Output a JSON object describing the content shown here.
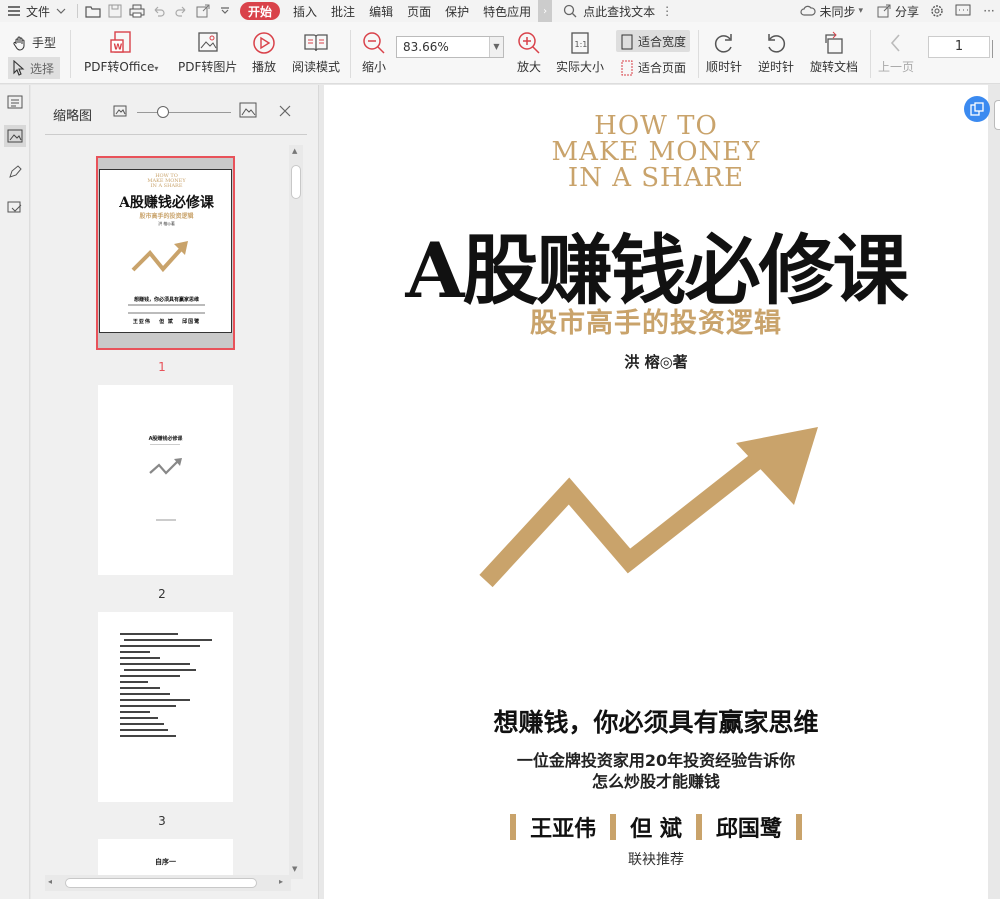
{
  "menu": {
    "file": "文件",
    "tabs": [
      "开始",
      "插入",
      "批注",
      "编辑",
      "页面",
      "保护",
      "特色应用"
    ],
    "search": "点此查找文本",
    "sync": "未同步",
    "share": "分享"
  },
  "toolbar": {
    "hand": "手型",
    "select": "选择",
    "pdf_to_office": "PDF转Office",
    "pdf_to_image": "PDF转图片",
    "play": "播放",
    "read_mode": "阅读模式",
    "zoom_out": "缩小",
    "zoom_value": "83.66%",
    "zoom_in": "放大",
    "actual_size": "实际大小",
    "fit_width": "适合宽度",
    "fit_page": "适合页面",
    "rotate_cw": "顺时针",
    "rotate_ccw": "逆时针",
    "rotate_doc": "旋转文档",
    "prev_page": "上一页",
    "page_number": "1"
  },
  "sidebar": {
    "title": "缩略图",
    "pages": [
      "1",
      "2",
      "3"
    ],
    "thumb1": {
      "en": "HOW TO\nMAKE MONEY\nIN A SHARE",
      "title": "A股赚钱必修课",
      "sub": "股市高手的投资逻辑",
      "author": "洪 榕◎著",
      "slogan": "想赚钱，你必须具有赢家思维",
      "names": [
        "王亚伟",
        "但 斌",
        "邱国鹭"
      ]
    },
    "thumb2": {
      "title": "A股赚钱必修课"
    },
    "thumb4": {
      "title": "自序一"
    }
  },
  "document": {
    "en_title_lines": [
      "HOW TO",
      "MAKE MONEY",
      "IN A SHARE"
    ],
    "title": "A股赚钱必修课",
    "subtitle": "股市高手的投资逻辑",
    "author": "洪 榕◎著",
    "slogan": "想赚钱，你必须具有赢家思维",
    "desc_line1": "一位金牌投资家用20年投资经验告诉你",
    "desc_line2": "怎么炒股才能赚钱",
    "endorsers": [
      "王亚伟",
      "但  斌",
      "邱国鹭"
    ],
    "recommend": "联袂推荐"
  },
  "colors": {
    "accent": "#c9a36b",
    "active_tab": "#d9424a",
    "selection": "#e8525a"
  }
}
